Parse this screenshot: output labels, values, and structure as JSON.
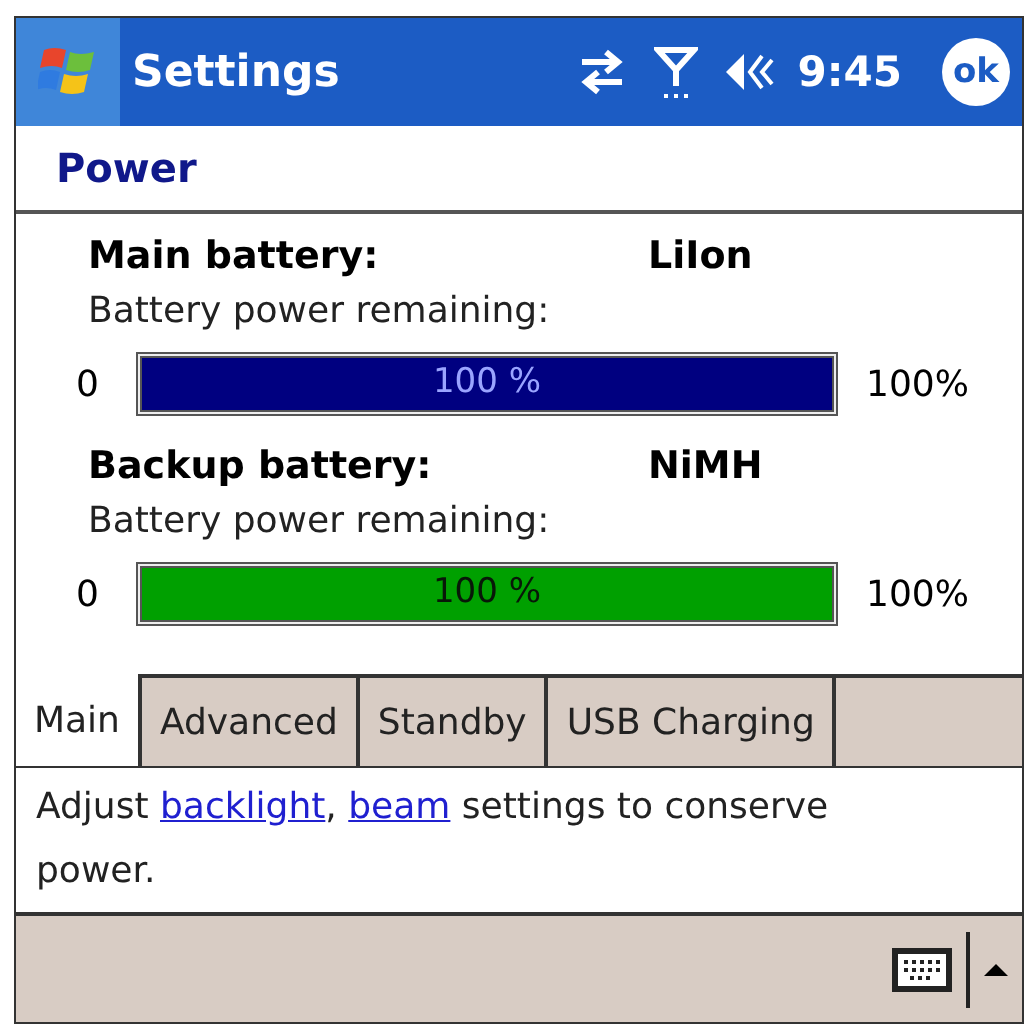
{
  "title_bar": {
    "title": "Settings",
    "time": "9:45",
    "ok": "ok"
  },
  "header": "Power",
  "batteries": [
    {
      "label": "Main battery:",
      "type": "LiIon",
      "caption": "Battery power remaining:",
      "min": "0",
      "max": "100%",
      "level": 1,
      "bar_text": "100 %",
      "color": "#000080"
    },
    {
      "label": "Backup battery:",
      "type": "NiMH",
      "caption": "Battery power remaining:",
      "min": "0",
      "max": "100%",
      "level": 1,
      "bar_text": "100 %",
      "color": "#00a000"
    }
  ],
  "tabs": [
    {
      "label": "Main",
      "selected": true
    },
    {
      "label": "Advanced",
      "selected": false
    },
    {
      "label": "Standby",
      "selected": false
    },
    {
      "label": "USB Charging",
      "selected": false
    }
  ],
  "description": [
    {
      "kind": "text",
      "text": "Adjust "
    },
    {
      "kind": "link",
      "text": "backlight"
    },
    {
      "kind": "text",
      "text": ", "
    },
    {
      "kind": "link",
      "text": "beam"
    },
    {
      "kind": "text",
      "text": " settings to conserve power."
    }
  ]
}
